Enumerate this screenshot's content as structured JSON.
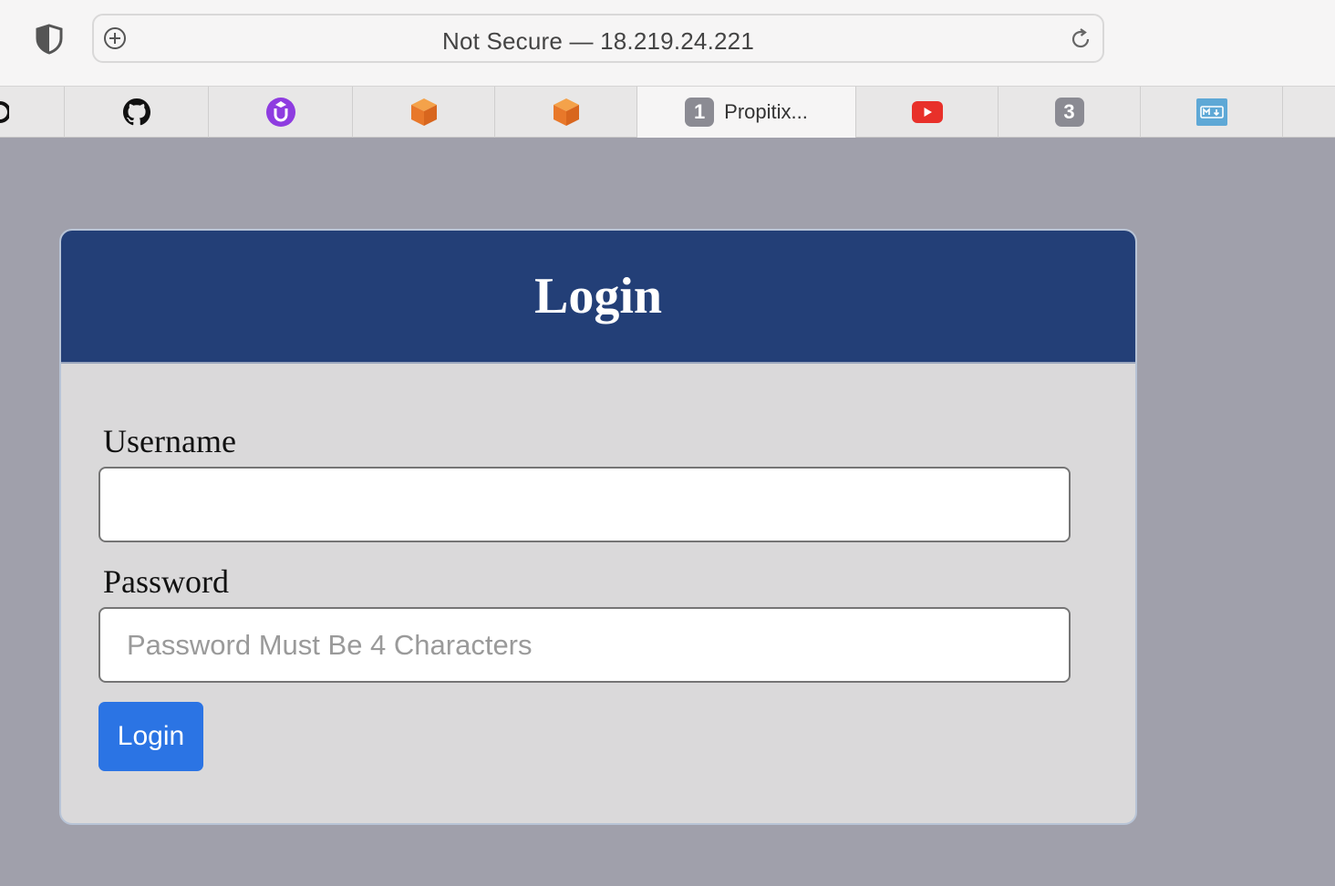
{
  "browser": {
    "url_text": "Not Secure — 18.219.24.221",
    "tabs": [
      {
        "icon": "github-icon"
      },
      {
        "icon": "udemy-icon"
      },
      {
        "icon": "orange-cube-icon"
      },
      {
        "icon": "orange-cube-icon"
      },
      {
        "icon": "badge-1-icon",
        "badge": "1",
        "title": "Propitix..."
      },
      {
        "icon": "youtube-icon"
      },
      {
        "icon": "badge-3-icon",
        "badge": "3"
      },
      {
        "icon": "markdown-icon"
      }
    ]
  },
  "form": {
    "title": "Login",
    "username_label": "Username",
    "username_value": "",
    "password_label": "Password",
    "password_placeholder": "Password Must Be 4 Characters",
    "submit_label": "Login"
  },
  "colors": {
    "page_bg": "#a0a0ab",
    "header_bg": "#233f77",
    "card_bg": "#dad9da",
    "button_bg": "#2b74e4"
  }
}
